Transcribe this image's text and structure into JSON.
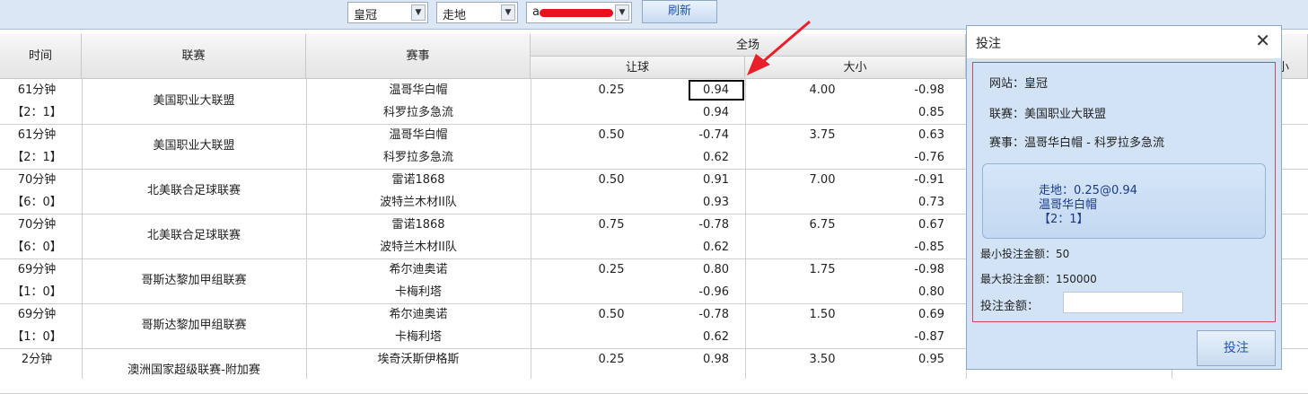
{
  "toolbar": {
    "site_select": "皇冠",
    "type_select": "走地",
    "account_select": "a",
    "refresh_label": "刷新"
  },
  "table": {
    "headers": {
      "time": "时间",
      "league": "联赛",
      "match": "赛事",
      "full_time": "全场",
      "handicap": "让球",
      "over_under": "大小",
      "partial": "小"
    },
    "rows": [
      {
        "time": "61分钟",
        "score": "【2：1】",
        "league": "美国职业大联盟",
        "home": "温哥华白帽",
        "away": "科罗拉多急流",
        "hdp_line": "0.25",
        "hdp_home": "0.94",
        "hdp_away": "0.94",
        "ou_line": "4.00",
        "ou_over": "-0.98",
        "ou_under": "0.85"
      },
      {
        "time": "61分钟",
        "score": "【2：1】",
        "league": "美国职业大联盟",
        "home": "温哥华白帽",
        "away": "科罗拉多急流",
        "hdp_line": "0.50",
        "hdp_home": "-0.74",
        "hdp_away": "0.62",
        "ou_line": "3.75",
        "ou_over": "0.63",
        "ou_under": "-0.76"
      },
      {
        "time": "70分钟",
        "score": "【6：0】",
        "league": "北美联合足球联赛",
        "home": "雷诺1868",
        "away": "波特兰木材II队",
        "hdp_line": "0.50",
        "hdp_home": "0.91",
        "hdp_away": "0.93",
        "ou_line": "7.00",
        "ou_over": "-0.91",
        "ou_under": "0.73"
      },
      {
        "time": "70分钟",
        "score": "【6：0】",
        "league": "北美联合足球联赛",
        "home": "雷诺1868",
        "away": "波特兰木材II队",
        "hdp_line": "0.75",
        "hdp_home": "-0.78",
        "hdp_away": "0.62",
        "ou_line": "6.75",
        "ou_over": "0.67",
        "ou_under": "-0.85"
      },
      {
        "time": "69分钟",
        "score": "【1：0】",
        "league": "哥斯达黎加甲组联赛",
        "home": "希尔迪奥诺",
        "away": "卡梅利塔",
        "hdp_line": "0.25",
        "hdp_home": "0.80",
        "hdp_away": "-0.96",
        "ou_line": "1.75",
        "ou_over": "-0.98",
        "ou_under": "0.80"
      },
      {
        "time": "69分钟",
        "score": "【1：0】",
        "league": "哥斯达黎加甲组联赛",
        "home": "希尔迪奥诺",
        "away": "卡梅利塔",
        "hdp_line": "0.50",
        "hdp_home": "-0.78",
        "hdp_away": "0.62",
        "ou_line": "1.50",
        "ou_over": "0.69",
        "ou_under": "-0.87"
      },
      {
        "time": "2分钟",
        "score": "",
        "league": "澳洲国家超级联赛-附加赛",
        "home": "埃奇沃斯伊格斯",
        "away": "",
        "hdp_line": "0.25",
        "hdp_home": "0.98",
        "hdp_away": "",
        "ou_line": "3.50",
        "ou_over": "0.95",
        "ou_under": ""
      }
    ]
  },
  "dialog": {
    "title": "投注",
    "close": "✕",
    "site": "网站：皇冠",
    "league": "联赛：美国职业大联盟",
    "match": "赛事：温哥华白帽 - 科罗拉多急流",
    "bet_line1": "走地：0.25@0.94",
    "bet_line2": "温哥华白帽",
    "bet_line3": "【2：1】",
    "min_bet": "最小投注金额：50",
    "max_bet": "最大投注金额：150000",
    "amount_label": "投注金额：",
    "amount_value": "",
    "submit_label": "投注"
  },
  "colors": {
    "annotation_arrow": "#e8202a",
    "highlight_border": "#000000"
  }
}
